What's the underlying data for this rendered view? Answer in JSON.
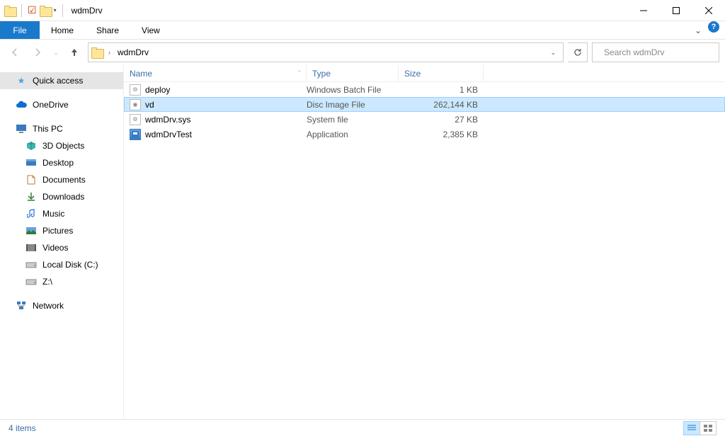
{
  "window": {
    "title": "wdmDrv"
  },
  "ribbon": {
    "file": "File",
    "tabs": [
      "Home",
      "Share",
      "View"
    ]
  },
  "address": {
    "crumbs": [
      "wdmDrv"
    ]
  },
  "search": {
    "placeholder": "Search wdmDrv"
  },
  "navpane": {
    "quick_access": "Quick access",
    "onedrive": "OneDrive",
    "this_pc": "This PC",
    "children": [
      {
        "key": "3d",
        "label": "3D Objects"
      },
      {
        "key": "desktop",
        "label": "Desktop"
      },
      {
        "key": "documents",
        "label": "Documents"
      },
      {
        "key": "downloads",
        "label": "Downloads"
      },
      {
        "key": "music",
        "label": "Music"
      },
      {
        "key": "pictures",
        "label": "Pictures"
      },
      {
        "key": "videos",
        "label": "Videos"
      },
      {
        "key": "diskc",
        "label": "Local Disk (C:)"
      },
      {
        "key": "diskz",
        "label": "Z:\\"
      }
    ],
    "network": "Network"
  },
  "columns": {
    "name": "Name",
    "type": "Type",
    "size": "Size"
  },
  "files": [
    {
      "name": "deploy",
      "type": "Windows Batch File",
      "size": "1 KB",
      "icon": "batch",
      "selected": false
    },
    {
      "name": "vd",
      "type": "Disc Image File",
      "size": "262,144 KB",
      "icon": "disc",
      "selected": true
    },
    {
      "name": "wdmDrv.sys",
      "type": "System file",
      "size": "27 KB",
      "icon": "sys",
      "selected": false
    },
    {
      "name": "wdmDrvTest",
      "type": "Application",
      "size": "2,385 KB",
      "icon": "app",
      "selected": false
    }
  ],
  "status": {
    "items": "4 items"
  }
}
